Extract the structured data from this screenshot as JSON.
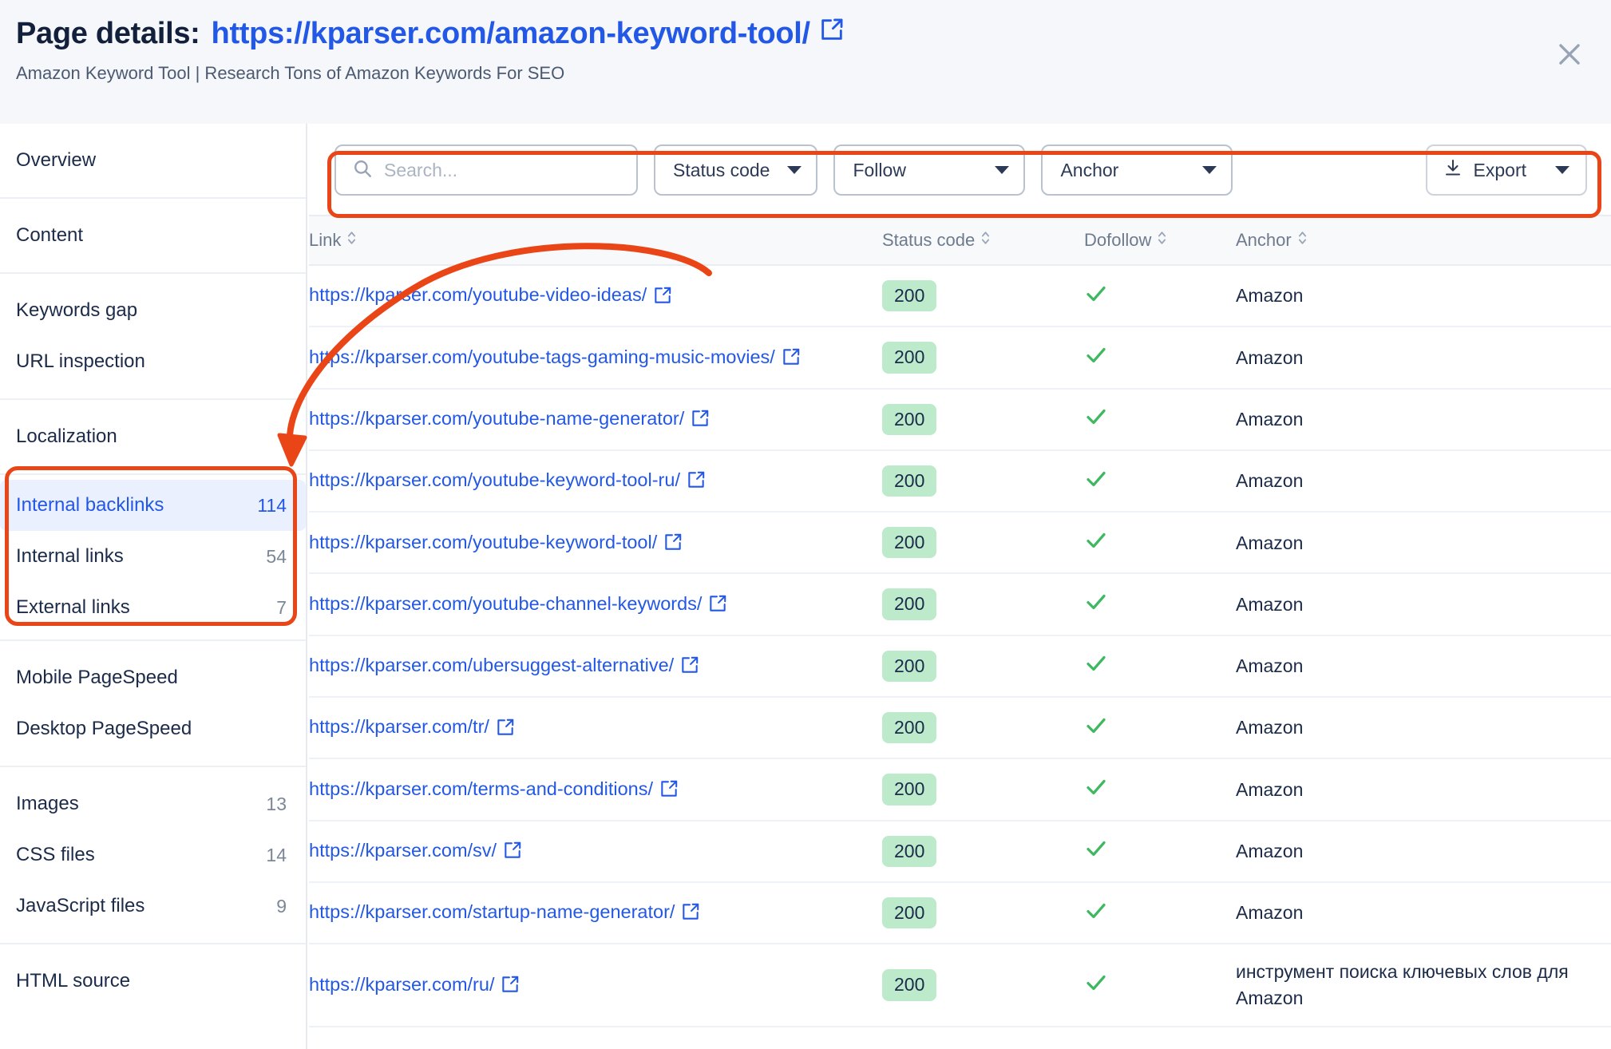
{
  "header": {
    "label": "Page details:",
    "url": "https://kparser.com/amazon-keyword-tool/",
    "subtitle": "Amazon Keyword Tool | Research Tons of Amazon Keywords For SEO",
    "close_icon": "close-icon",
    "external_link_icon": "external-link-icon"
  },
  "sidebar": {
    "groups": [
      {
        "items": [
          {
            "label": "Overview",
            "count": ""
          }
        ]
      },
      {
        "items": [
          {
            "label": "Content",
            "count": ""
          }
        ]
      },
      {
        "items": [
          {
            "label": "Keywords gap",
            "count": ""
          },
          {
            "label": "URL inspection",
            "count": ""
          }
        ]
      },
      {
        "items": [
          {
            "label": "Localization",
            "count": ""
          }
        ]
      },
      {
        "items": [
          {
            "label": "Internal backlinks",
            "count": "114",
            "active": true
          },
          {
            "label": "Internal links",
            "count": "54"
          },
          {
            "label": "External links",
            "count": "7"
          }
        ]
      },
      {
        "items": [
          {
            "label": "Mobile PageSpeed",
            "count": ""
          },
          {
            "label": "Desktop PageSpeed",
            "count": ""
          }
        ]
      },
      {
        "items": [
          {
            "label": "Images",
            "count": "13"
          },
          {
            "label": "CSS files",
            "count": "14"
          },
          {
            "label": "JavaScript files",
            "count": "9"
          }
        ]
      },
      {
        "items": [
          {
            "label": "HTML source",
            "count": ""
          }
        ]
      }
    ]
  },
  "toolbar": {
    "search_placeholder": "Search...",
    "search_value": "",
    "search_icon": "search-icon",
    "filters": [
      {
        "label": "Status code",
        "icon": "chevron-down-icon"
      },
      {
        "label": "Follow",
        "icon": "chevron-down-icon"
      },
      {
        "label": "Anchor",
        "icon": "chevron-down-icon"
      }
    ],
    "export_label": "Export",
    "export_icon": "download-icon",
    "export_caret": "chevron-down-icon"
  },
  "table": {
    "columns": [
      {
        "key": "link",
        "label": "Link",
        "sortable": true
      },
      {
        "key": "status",
        "label": "Status code",
        "sortable": true
      },
      {
        "key": "dofollow",
        "label": "Dofollow",
        "sortable": true
      },
      {
        "key": "anchor",
        "label": "Anchor",
        "sortable": true
      }
    ],
    "rows": [
      {
        "link": "https://kparser.com/youtube-video-ideas/",
        "status": "200",
        "dofollow": true,
        "anchor": "Amazon"
      },
      {
        "link": "https://kparser.com/youtube-tags-gaming-music-movies/",
        "status": "200",
        "dofollow": true,
        "anchor": "Amazon"
      },
      {
        "link": "https://kparser.com/youtube-name-generator/",
        "status": "200",
        "dofollow": true,
        "anchor": "Amazon"
      },
      {
        "link": "https://kparser.com/youtube-keyword-tool-ru/",
        "status": "200",
        "dofollow": true,
        "anchor": "Amazon"
      },
      {
        "link": "https://kparser.com/youtube-keyword-tool/",
        "status": "200",
        "dofollow": true,
        "anchor": "Amazon"
      },
      {
        "link": "https://kparser.com/youtube-channel-keywords/",
        "status": "200",
        "dofollow": true,
        "anchor": "Amazon"
      },
      {
        "link": "https://kparser.com/ubersuggest-alternative/",
        "status": "200",
        "dofollow": true,
        "anchor": "Amazon"
      },
      {
        "link": "https://kparser.com/tr/",
        "status": "200",
        "dofollow": true,
        "anchor": "Amazon"
      },
      {
        "link": "https://kparser.com/terms-and-conditions/",
        "status": "200",
        "dofollow": true,
        "anchor": "Amazon"
      },
      {
        "link": "https://kparser.com/sv/",
        "status": "200",
        "dofollow": true,
        "anchor": "Amazon"
      },
      {
        "link": "https://kparser.com/startup-name-generator/",
        "status": "200",
        "dofollow": true,
        "anchor": "Amazon"
      },
      {
        "link": "https://kparser.com/ru/",
        "status": "200",
        "dofollow": true,
        "anchor": "инструмент поиска ключевых слов для Amazon"
      }
    ]
  },
  "annotations": {
    "highlight_color": "#ea4516",
    "arrow": "curved-arrow-from-table-to-internal-backlinks"
  },
  "colors": {
    "accent_blue": "#2358e6",
    "text_dark": "#1b2b49",
    "muted": "#6e7a8e",
    "badge_green_bg": "#bdeacb",
    "check_green": "#3fb862",
    "annotation_red": "#ea4516"
  }
}
